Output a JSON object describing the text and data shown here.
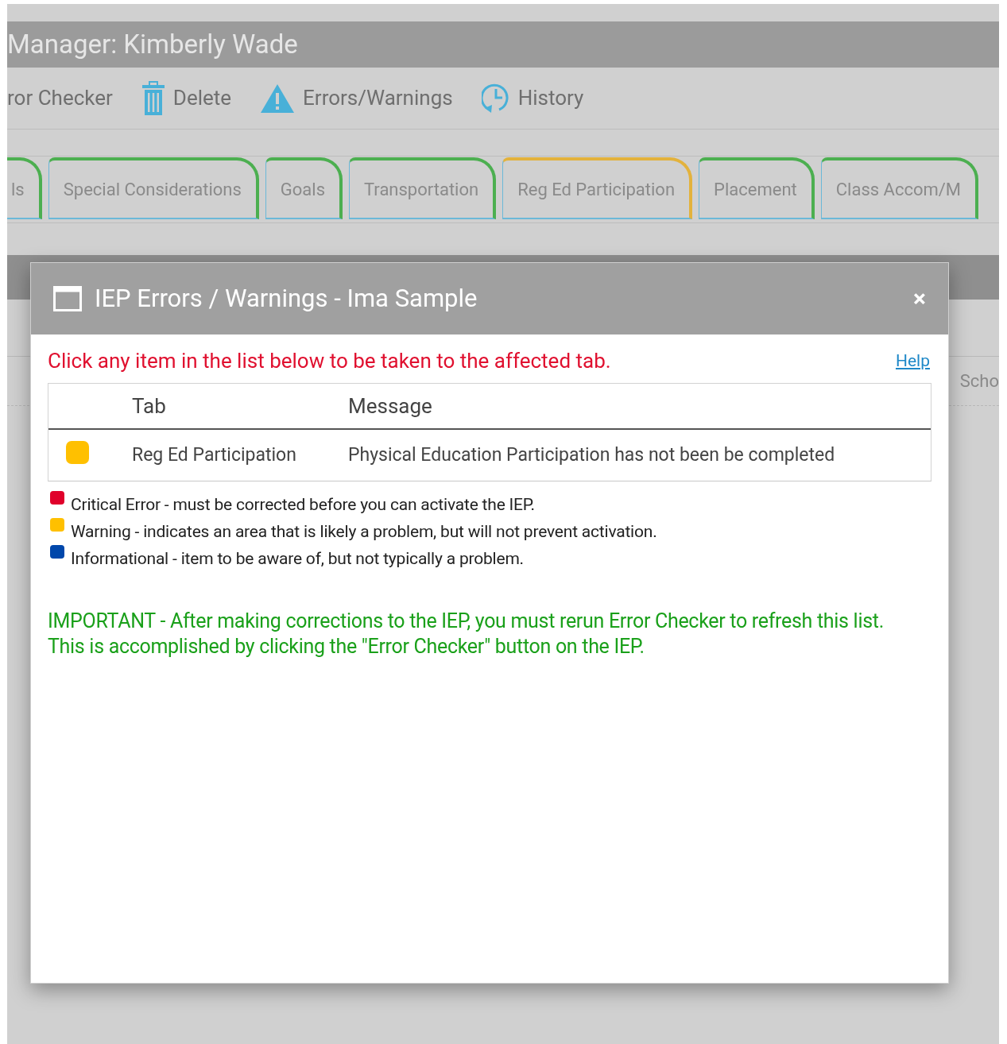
{
  "page_header": {
    "title": "Manager: Kimberly Wade"
  },
  "toolbar": [
    {
      "kind": "text",
      "label": "ror Checker"
    },
    {
      "kind": "trash",
      "label": "Delete"
    },
    {
      "kind": "warning",
      "label": "Errors/Warnings"
    },
    {
      "kind": "history",
      "label": "History"
    }
  ],
  "tabs": [
    {
      "label": "ls",
      "color": "#4caf50"
    },
    {
      "label": "Special Considerations",
      "color": "#4caf50"
    },
    {
      "label": "Goals",
      "color": "#4caf50"
    },
    {
      "label": "Transportation",
      "color": "#4caf50"
    },
    {
      "label": "Reg Ed Participation",
      "color": "#e3b23c"
    },
    {
      "label": "Placement",
      "color": "#4caf50"
    },
    {
      "label": "Class Accom/M",
      "color": "#4caf50"
    }
  ],
  "background_text": "Scho",
  "dialog": {
    "title": "IEP Errors / Warnings - Ima Sample",
    "close": "×",
    "instruction": "Click any item in the list below to be taken to the affected tab.",
    "help_link": "Help",
    "table": {
      "columns": [
        "Tab",
        "Message"
      ],
      "rows": [
        {
          "color": "#ffc000",
          "tab": "Reg Ed Participation",
          "message": "Physical Education Participation has not been be completed"
        }
      ]
    },
    "legend": [
      {
        "color": "#e0002b",
        "text": "Critical Error - must be corrected before you can activate the IEP."
      },
      {
        "color": "#ffc000",
        "text": "Warning - indicates an area that is likely a problem, but will not prevent activation."
      },
      {
        "color": "#0047ab",
        "text": "Informational - item to be aware of, but not typically a problem."
      }
    ],
    "important_note": "IMPORTANT - After making corrections to the IEP, you must rerun Error Checker to refresh this list. This is accomplished by clicking the \"Error Checker\" button on the IEP."
  }
}
